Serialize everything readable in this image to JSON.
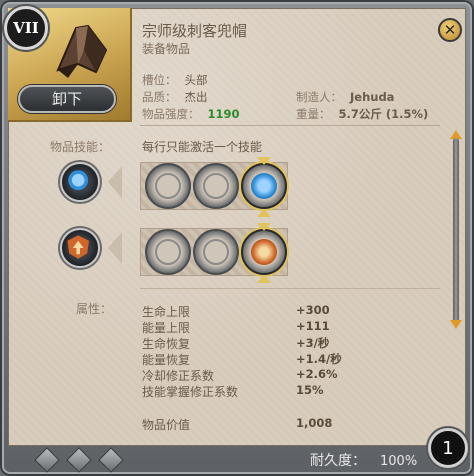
{
  "item": {
    "tier_badge": "VII",
    "name": "宗师级刺客兜帽",
    "category": "装备物品",
    "unequip_label": "卸下",
    "slot_label": "槽位：",
    "slot_value": "头部",
    "quality_label": "品质：",
    "quality_value": "杰出",
    "power_label": "物品强度：",
    "power_value": "1190",
    "crafter_label": "制造人：",
    "crafter_value": "Jehuda",
    "weight_label": "重量：",
    "weight_value": "5.7公斤 (1.5%)"
  },
  "skills": {
    "label": "物品技能：",
    "note": "每行只能激活一个技能"
  },
  "attributes": {
    "label": "属性：",
    "rows": [
      {
        "name": "生命上限",
        "value": "+300"
      },
      {
        "name": "能量上限",
        "value": "+111"
      },
      {
        "name": "生命恢复",
        "value": "+3/秒"
      },
      {
        "name": "能量恢复",
        "value": "+1.4/秒"
      },
      {
        "name": "冷却修正系数",
        "value": "+2.6%"
      },
      {
        "name": "技能掌握修正系数",
        "value": "15%"
      }
    ],
    "value_label": "物品价值",
    "value_amount": "1,008"
  },
  "footer": {
    "durability_label": "耐久度：",
    "durability_value": "100%",
    "stack_count": "1"
  },
  "colors": {
    "power_green": "#2e8a2e",
    "accent_gold": "#e2c25a",
    "scroll_orange": "#e09a2a"
  }
}
